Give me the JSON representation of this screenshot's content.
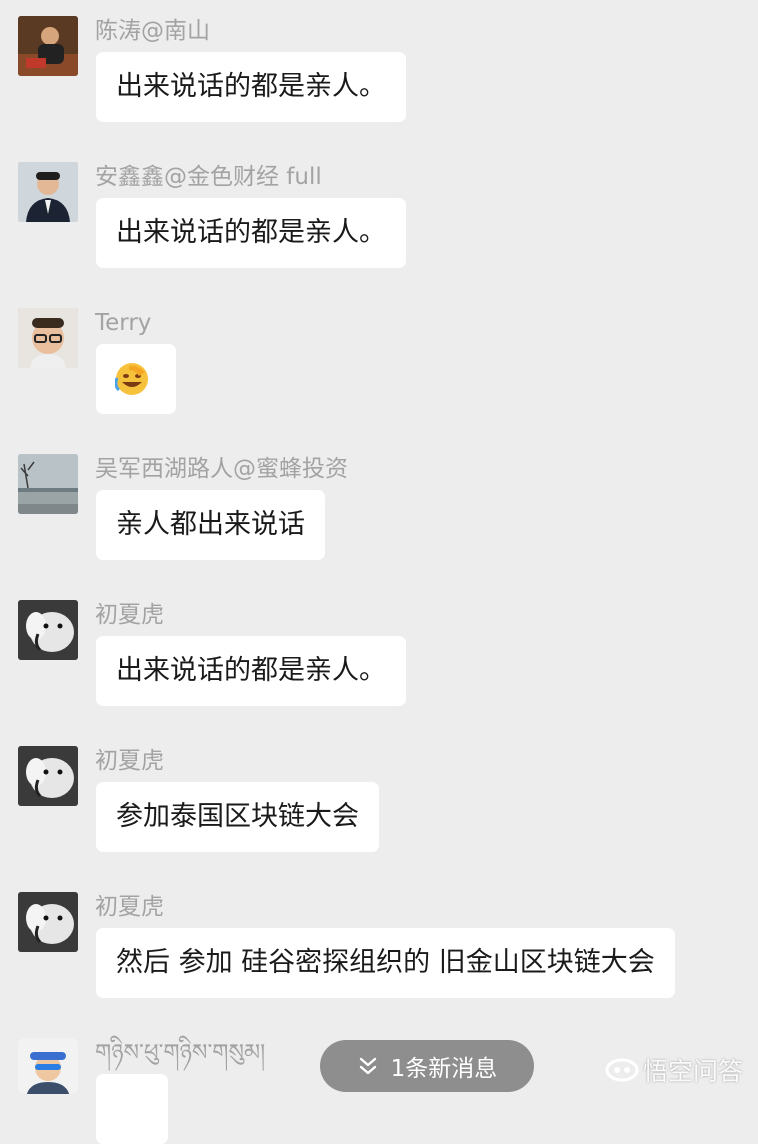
{
  "messages": [
    {
      "sender": "陈涛@南山",
      "text": "出来说话的都是亲人。"
    },
    {
      "sender": "安鑫鑫@金色财经 full",
      "text": "出来说话的都是亲人。"
    },
    {
      "sender": "Terry",
      "emoji": "facepalm-laughing-emoji"
    },
    {
      "sender": "吴军西湖路人@蜜蜂投资",
      "text": "亲人都出来说话"
    },
    {
      "sender": "初夏虎",
      "text": "出来说话的都是亲人。"
    },
    {
      "sender": "初夏虎",
      "text": "参加泰国区块链大会"
    },
    {
      "sender": "初夏虎",
      "text": "然后 参加 硅谷密探组织的 旧金山区块链大会"
    },
    {
      "sender": "གཉིས་ཕུ་གཉིས་གསུམ།",
      "text": "..."
    }
  ],
  "new_messages_pill": {
    "label": "1条新消息",
    "icon": "double-chevron-down-icon"
  },
  "watermark": {
    "text": "悟空问答",
    "icon": "wukong-logo-icon"
  },
  "colors": {
    "background": "#ededed",
    "bubble": "#ffffff",
    "sender_name": "#a3a3a3",
    "pill": "#8e8e8e"
  }
}
